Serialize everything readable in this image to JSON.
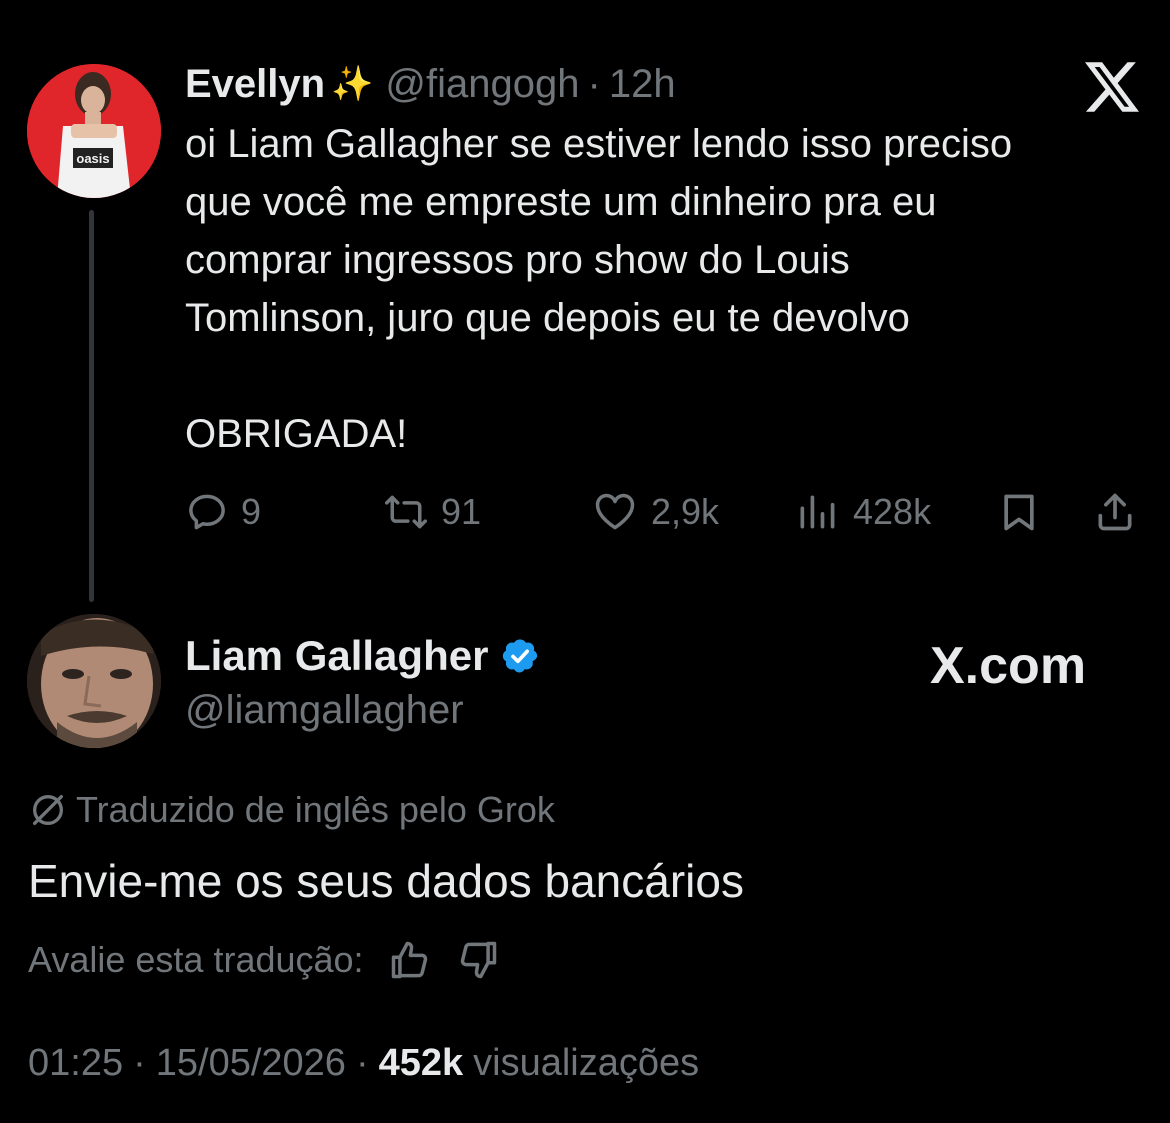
{
  "original_tweet": {
    "author_name": "Evellyn",
    "author_emoji": "✨",
    "handle": "@fiangogh",
    "separator": "·",
    "time": "12h",
    "avatar_shirt_text": "oasis",
    "text": "oi Liam Gallagher se estiver lendo isso preciso\nque você me empreste um dinheiro pra eu\ncomprar ingressos pro show do Louis\nTomlinson, juro que depois eu te devolvo\n\nOBRIGADA!",
    "stats": {
      "replies": "9",
      "retweets": "91",
      "likes": "2,9k",
      "views": "428k"
    }
  },
  "reply_tweet": {
    "author_name": "Liam Gallagher",
    "handle": "@liamgallagher",
    "verified": true,
    "watermark": "X.com",
    "translated_note": "Traduzido de inglês pelo Grok",
    "text": "Envie-me os seus dados bancários",
    "rate_label": "Avalie esta tradução:",
    "time": "01:25",
    "date": "15/05/2026",
    "views_count": "452k",
    "views_label": "visualizações",
    "separator": "·"
  },
  "colors": {
    "background": "#000000",
    "primary_text": "#e7e9ea",
    "secondary_text": "#71767b",
    "verified_blue": "#1d9bf0",
    "thread_line": "#333639"
  }
}
